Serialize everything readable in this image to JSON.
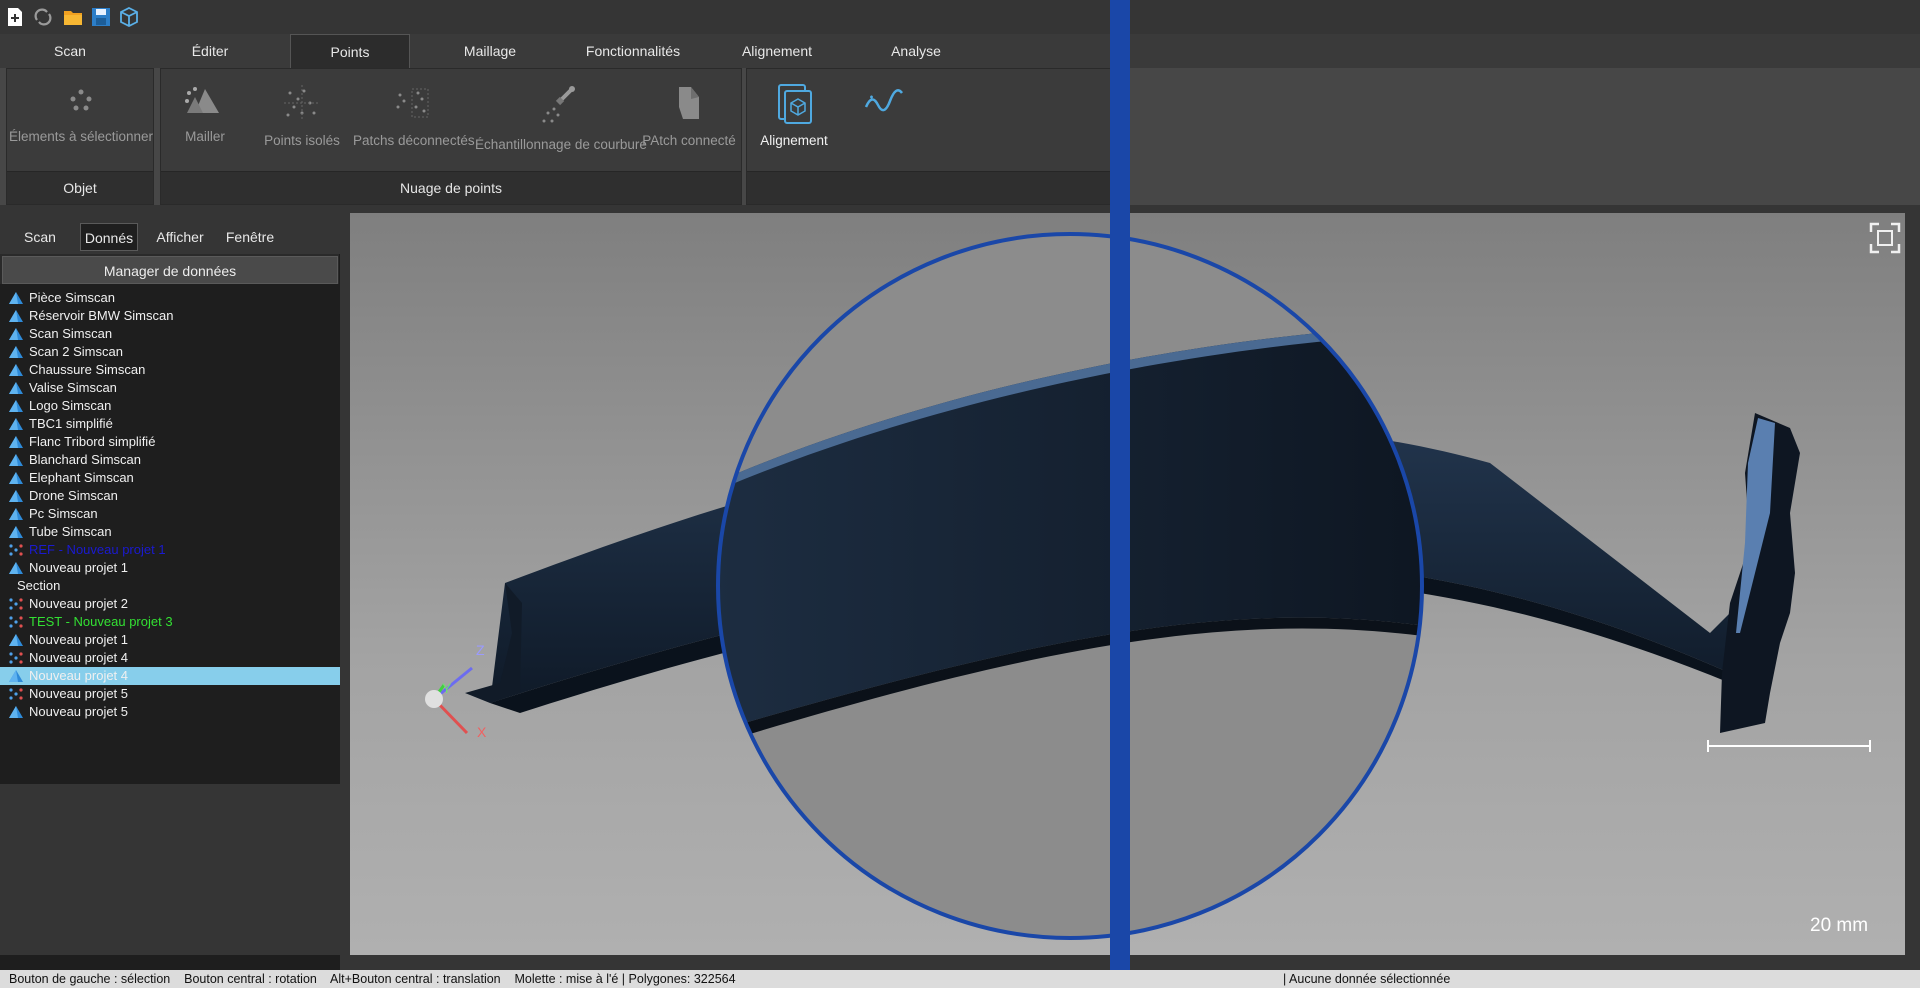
{
  "quick_access": [
    "new-file-icon",
    "sync-icon",
    "open-folder-icon",
    "save-icon",
    "cube-icon"
  ],
  "tabs": [
    {
      "label": "Scan"
    },
    {
      "label": "Éditer"
    },
    {
      "label": "Points"
    },
    {
      "label": "Maillage"
    },
    {
      "label": "Fonctionnalités"
    },
    {
      "label": "Alignement"
    },
    {
      "label": "Analyse"
    }
  ],
  "ribbon": {
    "groups": {
      "objet": {
        "label": "Objet",
        "buttons": [
          {
            "label": "Élements à sélectionner"
          }
        ]
      },
      "nuage": {
        "label": "Nuage de points",
        "buttons": [
          {
            "label": "Mailler"
          },
          {
            "label": "Points isolés"
          },
          {
            "label": "Patchs déconnectés"
          },
          {
            "label": "Échantillonnage de courbure"
          },
          {
            "label": "PAtch connecté"
          }
        ]
      },
      "alignement": {
        "buttons": [
          {
            "label": "Alignement"
          }
        ]
      }
    }
  },
  "left_panel": {
    "tabs": [
      {
        "label": "Scan"
      },
      {
        "label": "Donnés"
      },
      {
        "label": "Afficher"
      },
      {
        "label": "Fenêtre"
      }
    ],
    "manager_title": "Manager de données",
    "items": [
      {
        "label": "Pièce Simscan",
        "icon": "mesh-icon"
      },
      {
        "label": "Réservoir BMW Simscan",
        "icon": "mesh-icon"
      },
      {
        "label": "Scan Simscan",
        "icon": "mesh-icon"
      },
      {
        "label": "Scan 2 Simscan",
        "icon": "mesh-icon"
      },
      {
        "label": "Chaussure Simscan",
        "icon": "mesh-icon"
      },
      {
        "label": "Valise Simscan",
        "icon": "mesh-icon"
      },
      {
        "label": "Logo Simscan",
        "icon": "mesh-icon"
      },
      {
        "label": "TBC1 simplifié",
        "icon": "mesh-icon"
      },
      {
        "label": "Flanc Tribord simplifié",
        "icon": "mesh-icon"
      },
      {
        "label": "Blanchard Simscan",
        "icon": "mesh-icon"
      },
      {
        "label": "Elephant Simscan",
        "icon": "mesh-icon"
      },
      {
        "label": "Drone Simscan",
        "icon": "mesh-icon"
      },
      {
        "label": "Pc Simscan",
        "icon": "mesh-icon"
      },
      {
        "label": "Tube Simscan",
        "icon": "mesh-icon"
      },
      {
        "label": "REF - Nouveau projet 1",
        "icon": "point-cloud-icon",
        "color": "#1a1ad0"
      },
      {
        "label": "Nouveau projet 1",
        "icon": "mesh-icon"
      },
      {
        "label": "Section",
        "icon": ""
      },
      {
        "label": "Nouveau projet 2",
        "icon": "point-cloud-icon"
      },
      {
        "label": "TEST - Nouveau projet 3",
        "icon": "point-cloud-icon",
        "color": "#33e033"
      },
      {
        "label": "Nouveau projet 1",
        "icon": "mesh-icon"
      },
      {
        "label": "Nouveau projet 4",
        "icon": "point-cloud-icon"
      },
      {
        "label": "Nouveau projet 4",
        "icon": "mesh-icon",
        "selected": true
      },
      {
        "label": "Nouveau projet 5",
        "icon": "point-cloud-icon"
      },
      {
        "label": "Nouveau projet 5",
        "icon": "mesh-icon"
      }
    ]
  },
  "viewport": {
    "axis_labels": {
      "z": "Z",
      "y": "Y",
      "x": "X"
    },
    "scale_label": "20 mm"
  },
  "status": {
    "left": "Bouton de gauche : sélection    Bouton central : rotation    Alt+Bouton central : translation    Molette : mise à l'é | Polygones: 322564",
    "right": "| Aucune donnée sélectionnée"
  },
  "colors": {
    "accent_blue": "#1a47a8",
    "selection": "#87ceeb",
    "mesh": "#1a2a3f"
  }
}
